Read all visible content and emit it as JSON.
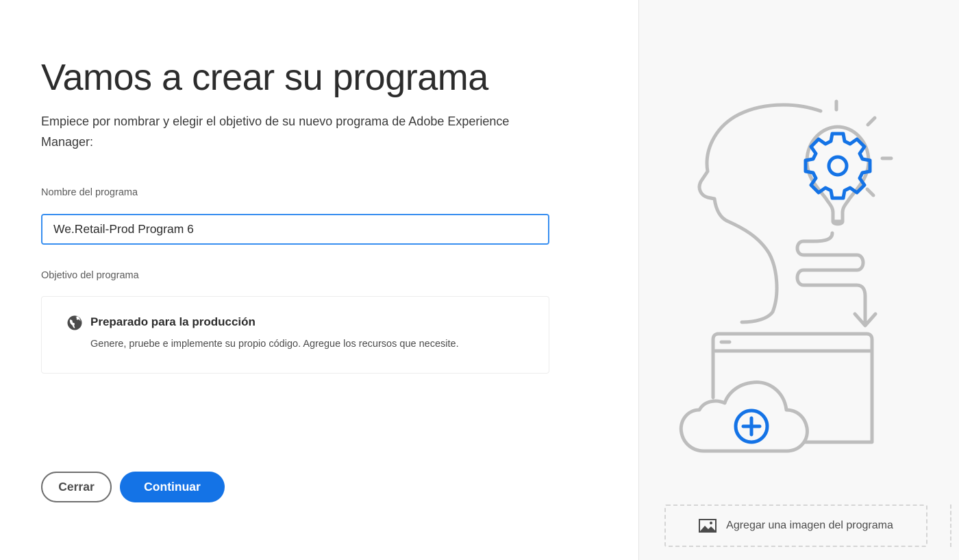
{
  "dialog": {
    "title": "Vamos a crear su programa",
    "subtitle": "Empiece por nombrar y elegir el objetivo de su nuevo programa de Adobe Experience Manager:"
  },
  "program_name": {
    "label": "Nombre del programa",
    "value": "We.Retail-Prod Program 6"
  },
  "program_goal": {
    "label": "Objetivo del programa",
    "option": {
      "icon": "globe-icon",
      "title": "Preparado para la producción",
      "description": "Genere, pruebe e implemente su propio código. Agregue los recursos que necesite."
    }
  },
  "actions": {
    "close_label": "Cerrar",
    "continue_label": "Continuar"
  },
  "side_panel": {
    "illustration": "head-lightbulb-gear-cloud-illustration",
    "add_image_icon": "image-icon",
    "add_image_label": "Agregar una imagen del programa"
  },
  "colors": {
    "accent": "#1473e6",
    "input_focus": "#378ef0",
    "illustration_gray": "#bdbdbd",
    "illustration_blue": "#1473e6"
  }
}
